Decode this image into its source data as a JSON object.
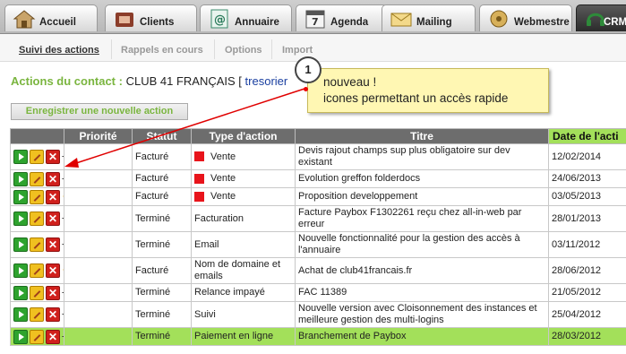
{
  "tabs": [
    {
      "label": "Accueil",
      "icon": "home-icon"
    },
    {
      "label": "Clients",
      "icon": "clients-icon"
    },
    {
      "label": "Annuaire",
      "icon": "directory-icon"
    },
    {
      "label": "Agenda",
      "icon": "calendar-icon"
    },
    {
      "label": "Mailing",
      "icon": "mail-icon"
    },
    {
      "label": "Webmestre",
      "icon": "webmaster-icon"
    },
    {
      "label": "CRM",
      "icon": "headset-icon",
      "active": true
    }
  ],
  "calendar_day": "7",
  "subtabs": [
    {
      "label": "Suivi des actions",
      "active": true
    },
    {
      "label": "Rappels en cours"
    },
    {
      "label": "Options"
    },
    {
      "label": "Import"
    }
  ],
  "contact": {
    "label": "Actions du contact :",
    "name": "CLUB 41 FRANÇAIS",
    "bracket": "[",
    "link": "tresorier"
  },
  "new_action_button": "Enregistrer une nouvelle action",
  "callout": {
    "number": "1",
    "line1": "nouveau !",
    "line2": "icones permettant un accès rapide"
  },
  "table": {
    "headers": [
      "Priorité",
      "Statut",
      "Type d'action",
      "Titre",
      "Date de l'acti"
    ],
    "rows": [
      {
        "priority": "-",
        "status": "Facturé",
        "type": "Vente",
        "type_marker": true,
        "title": "Devis rajout champs sup plus obligatoire sur dev existant",
        "date": "12/02/2014"
      },
      {
        "priority": "-",
        "status": "Facturé",
        "type": "Vente",
        "type_marker": true,
        "title": "Evolution greffon folderdocs",
        "date": "24/06/2013"
      },
      {
        "priority": "★★★",
        "status": "Facturé",
        "type": "Vente",
        "type_marker": true,
        "title": "Proposition developpement",
        "date": "03/05/2013"
      },
      {
        "priority": "-",
        "status": "Terminé",
        "type": "Facturation",
        "type_marker": false,
        "title": "Facture Paybox F1302261 reçu chez all-in-web par erreur",
        "date": "28/01/2013"
      },
      {
        "priority": "-",
        "status": "Terminé",
        "type": "Email",
        "type_marker": false,
        "title": "Nouvelle fonctionnalité pour la gestion des accès à l'annuaire",
        "date": "03/11/2012"
      },
      {
        "priority": "★",
        "status": "Facturé",
        "type": "Nom de domaine et emails",
        "type_marker": false,
        "title": "Achat de club41francais.fr",
        "date": "28/06/2012"
      },
      {
        "priority": "-",
        "status": "Terminé",
        "type": "Relance impayé",
        "type_marker": false,
        "title": "FAC 11389",
        "date": "21/05/2012"
      },
      {
        "priority": "-",
        "status": "Terminé",
        "type": "Suivi",
        "type_marker": false,
        "title": "Nouvelle version avec Cloisonnement des instances et meilleure gestion des multi-logins",
        "date": "25/04/2012"
      },
      {
        "priority": "-",
        "status": "Terminé",
        "type": "Paiement en ligne",
        "type_marker": false,
        "title": "Branchement de Paybox",
        "date": "28/03/2012",
        "highlight": true
      }
    ]
  },
  "colors": {
    "accent_green": "#7ab53f",
    "header_gray": "#6d6d6d",
    "highlight_row": "#a3e05a",
    "callout_bg": "#fff7b3",
    "arrow_red": "#e00000"
  }
}
